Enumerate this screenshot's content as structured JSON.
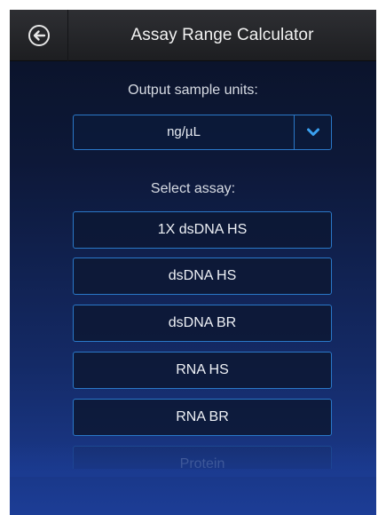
{
  "header": {
    "title": "Assay Range Calculator",
    "back_icon": "circle-arrow-left-icon"
  },
  "output_units": {
    "label": "Output sample units:",
    "selected": "ng/µL",
    "caret_icon": "chevron-down-icon"
  },
  "assay": {
    "label": "Select assay:",
    "options": [
      "1X dsDNA HS",
      "dsDNA HS",
      "dsDNA BR",
      "RNA HS",
      "RNA BR",
      "Protein"
    ]
  },
  "colors": {
    "accent_border": "#2a78c8",
    "caret": "#3aa0f0",
    "header_bg": "#26272b"
  }
}
